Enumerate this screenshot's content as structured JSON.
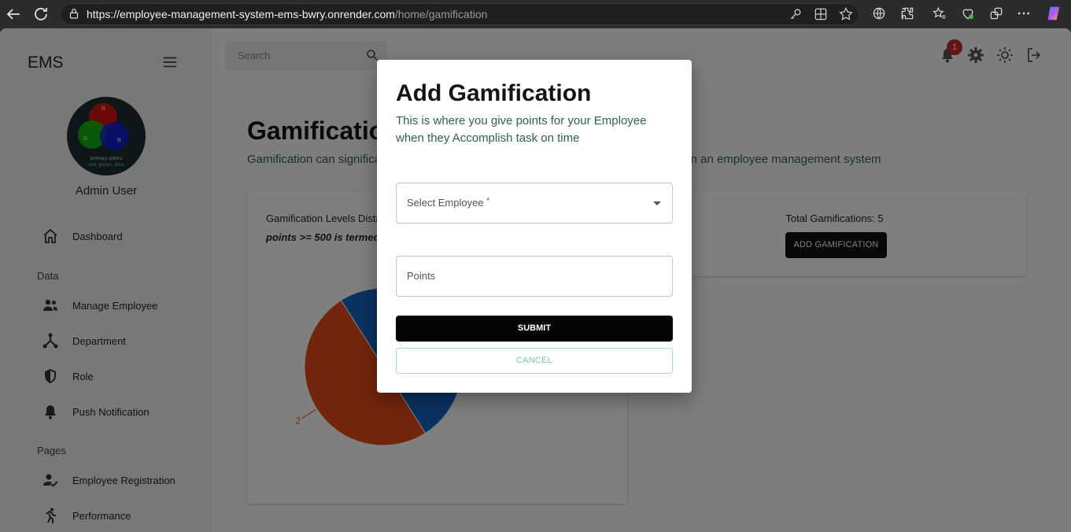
{
  "browser": {
    "url_host": "https://employee-management-system-ems-bwry.onrender.com",
    "url_path": "/home/gamification"
  },
  "sidebar": {
    "brand": "EMS",
    "avatar_caption": "primary colors",
    "avatar_caption2": "red, green, blue",
    "avatar_letters": [
      "R",
      "G",
      "B"
    ],
    "user_name": "Admin User",
    "sections": [
      {
        "label": "Data"
      },
      {
        "label": "Pages"
      }
    ],
    "items": [
      {
        "label": "Dashboard",
        "icon": "home-icon"
      },
      {
        "label": "Manage Employee",
        "icon": "people-icon"
      },
      {
        "label": "Department",
        "icon": "hierarchy-icon"
      },
      {
        "label": "Role",
        "icon": "shield-icon"
      },
      {
        "label": "Push Notification",
        "icon": "bell-icon"
      },
      {
        "label": "Employee Registration",
        "icon": "person-check-icon"
      },
      {
        "label": "Performance",
        "icon": "runner-icon"
      }
    ]
  },
  "header": {
    "search_placeholder": "Search",
    "notification_count": "1"
  },
  "page": {
    "title": "Gamification",
    "subtitle": "Gamification can significantly enhance employee engagement and performance within an employee management system",
    "levels_card_title": "Gamification Levels Distribution",
    "levels_card_note": "points >= 500 is termed",
    "total_label": "Total Gamifications: 5",
    "add_button": "ADD GAMIFICATION"
  },
  "chart_data": {
    "type": "pie",
    "values": [
      2,
      2
    ],
    "colors": [
      "#1565c0",
      "#e64a19"
    ],
    "labels": [
      "2",
      "2"
    ]
  },
  "modal": {
    "title": "Add Gamification",
    "description": "This is where you give points for your Employee when they Accomplish task on time",
    "employee_label": "Select Employee",
    "required_mark": "*",
    "points_label": "Points",
    "submit_label": "SUBMIT",
    "cancel_label": "CANCEL"
  },
  "colors": {
    "accent_green": "#2e6250",
    "cancel_teal": "#7cc7b4",
    "badge_red": "#c62828"
  }
}
